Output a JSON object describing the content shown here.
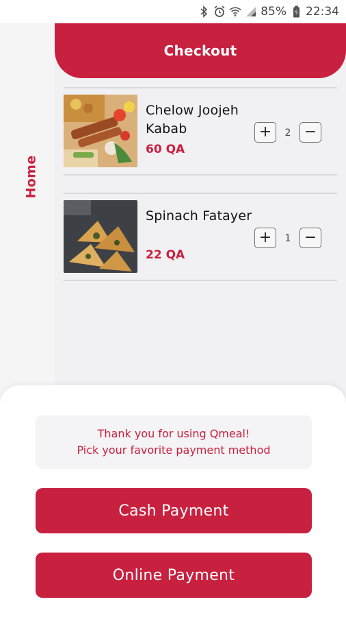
{
  "status_bar": {
    "battery": "85%",
    "time": "22:34",
    "icons": [
      "bluetooth-icon",
      "alarm-icon",
      "wifi-icon",
      "signal-icon",
      "battery-icon"
    ]
  },
  "nav": {
    "home_label": "Home"
  },
  "header": {
    "title": "Checkout"
  },
  "cart": {
    "items": [
      {
        "name": "Chelow Joojeh Kabab",
        "price": "60 QA",
        "quantity": "2",
        "image": "kabab-photo"
      },
      {
        "name": "Spinach Fatayer",
        "price": "22 QA",
        "quantity": "1",
        "image": "fatayer-photo"
      }
    ],
    "plus_symbol": "+",
    "minus_symbol": "−"
  },
  "sheet": {
    "message_line1": "Thank you for using Qmeal!",
    "message_line2": "Pick your favorite payment method",
    "cash_label": "Cash Payment",
    "online_label": "Online Payment"
  },
  "colors": {
    "accent": "#c8203f",
    "background": "#f6f5f6"
  }
}
